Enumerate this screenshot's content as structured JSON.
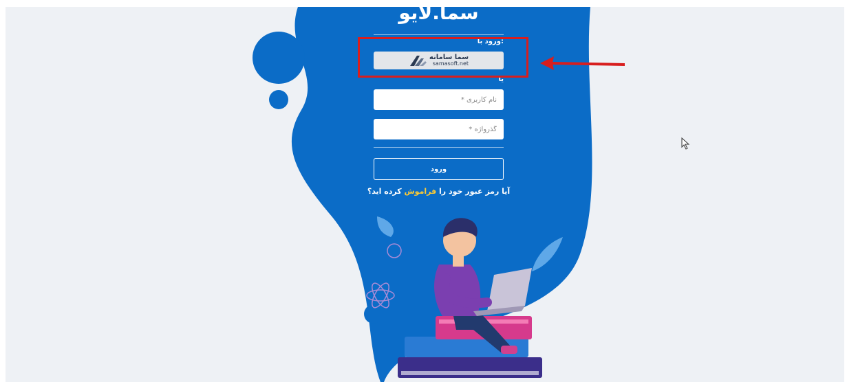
{
  "brand": {
    "title": "سما.لایو"
  },
  "login": {
    "login_with_label": "ورود با:",
    "sso": {
      "name_fa": "سما سامانه",
      "domain": "samasoft.net"
    },
    "or_label": "یا",
    "username": {
      "placeholder": "نام کاربری *",
      "value": ""
    },
    "password": {
      "placeholder": "گذرواژه *",
      "value": ""
    },
    "submit_label": "ورود",
    "forgot": {
      "before": "آیا رمز عبور خود را ",
      "link": "فراموش",
      "after": " کرده اید؟"
    }
  },
  "colors": {
    "blob": "#0b6cc7",
    "page_background": "#eef1f5",
    "highlight": "#d81e1e",
    "link": "#ffcc33"
  }
}
